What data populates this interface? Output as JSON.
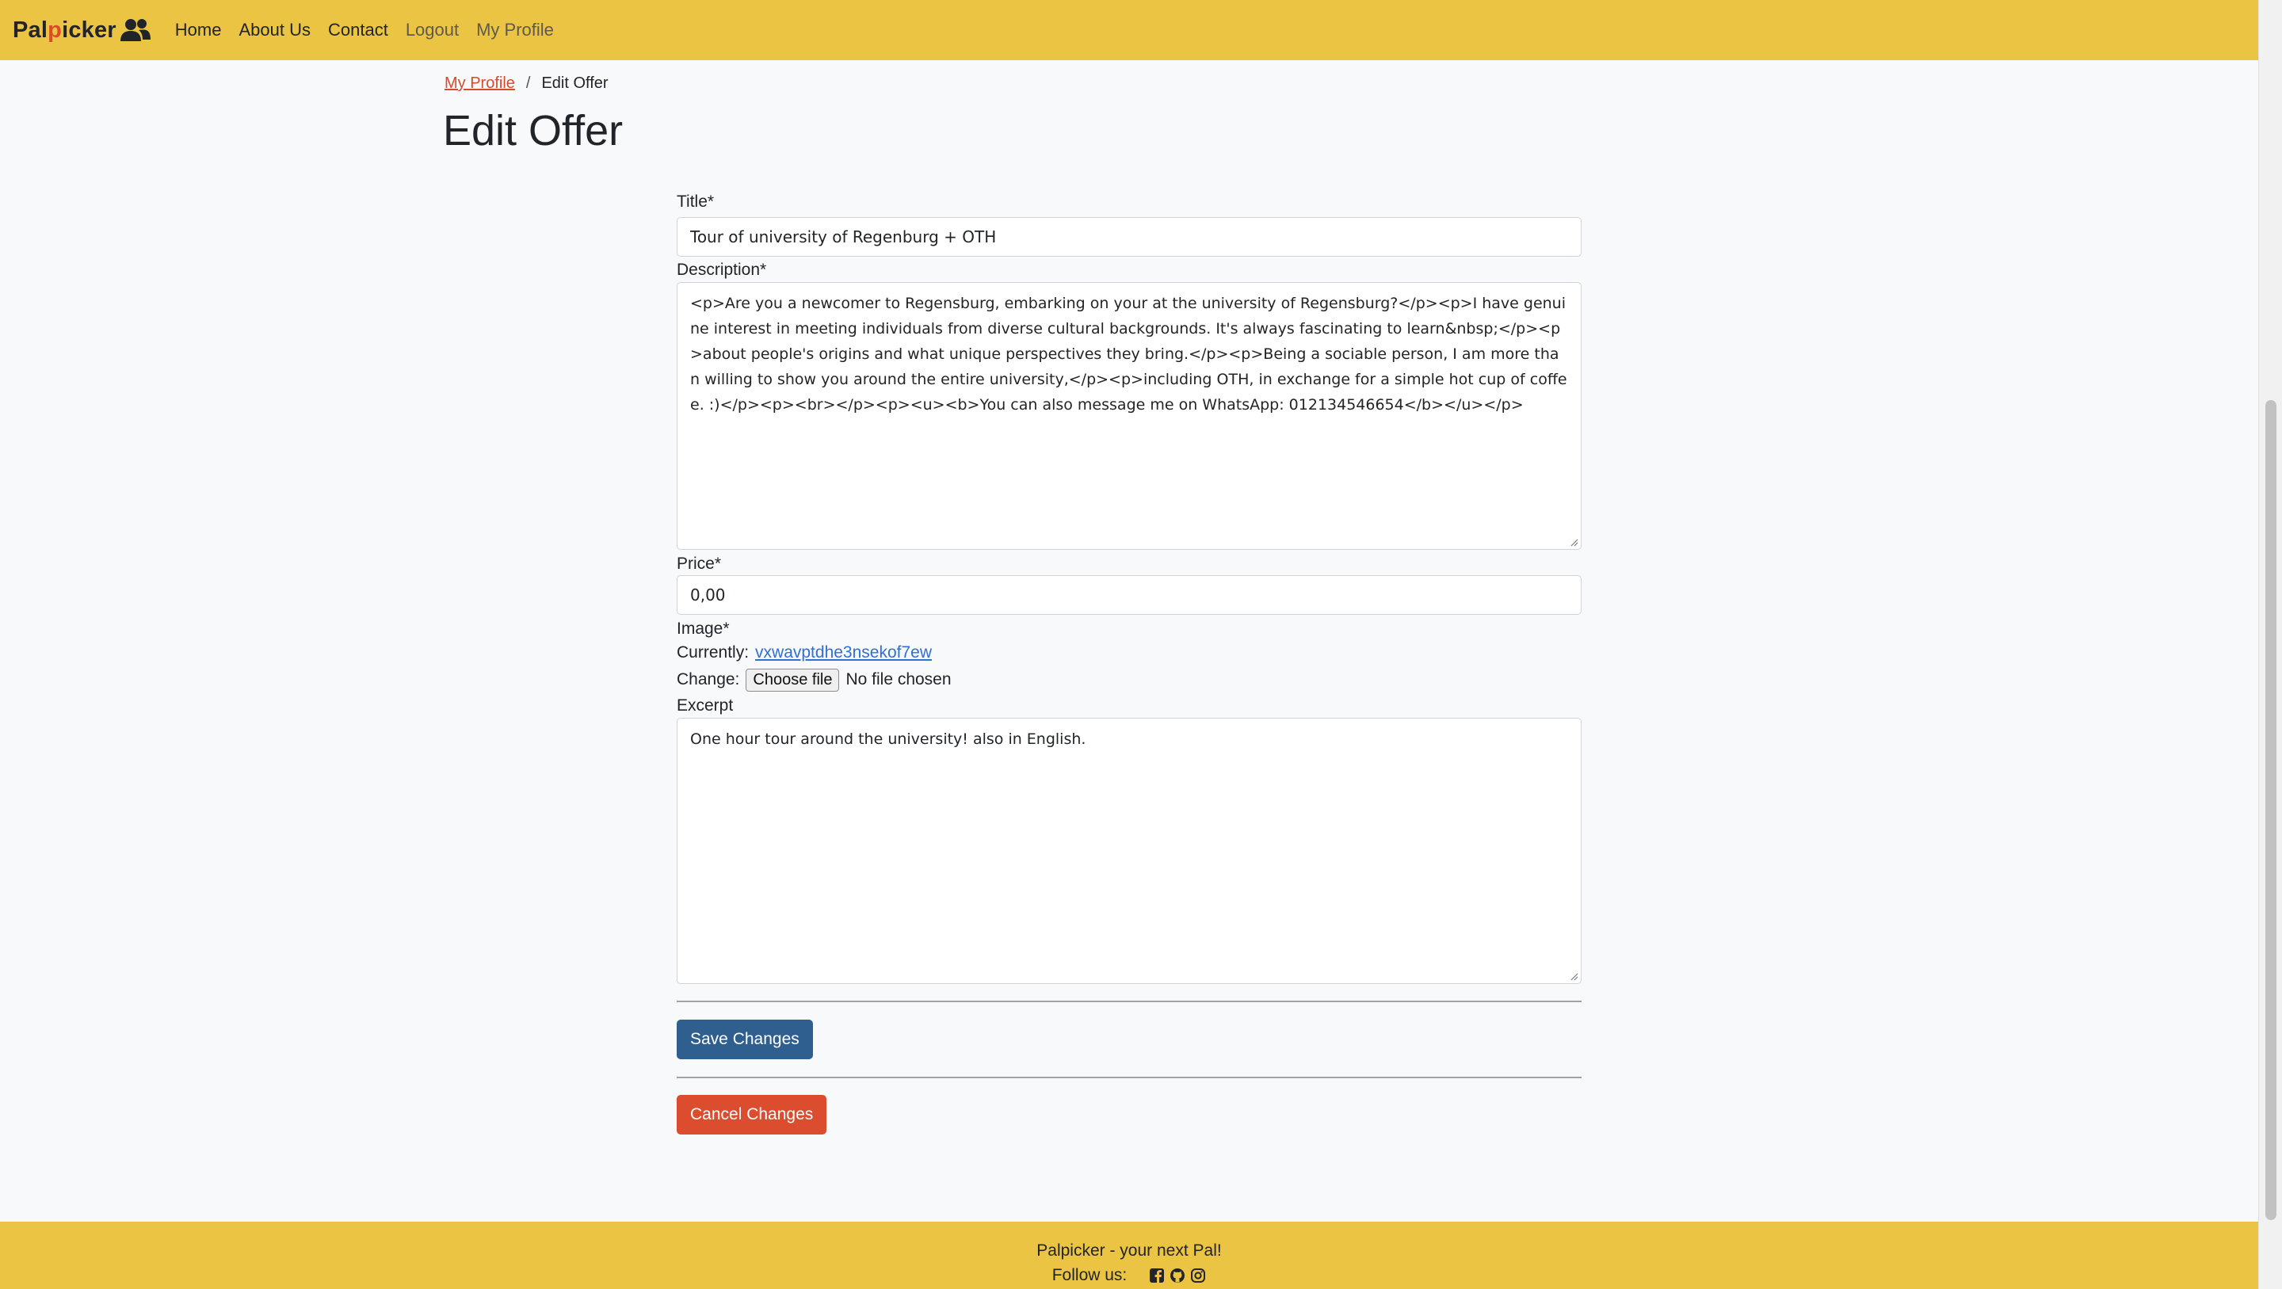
{
  "navbar": {
    "brand_pre": "Pal",
    "brand_p": "p",
    "brand_post": "icker",
    "links": [
      "Home",
      "About Us",
      "Contact",
      "Logout",
      "My Profile"
    ]
  },
  "breadcrumb": {
    "parent": "My Profile",
    "separator": "/",
    "current": "Edit Offer"
  },
  "page": {
    "title": "Edit Offer"
  },
  "form": {
    "title_label": "Title*",
    "title_value": "Tour of university of Regenburg + OTH",
    "description_label": "Description*",
    "description_value": "<p>Are you a newcomer to Regensburg, embarking on your at the university of Regensburg?</p><p>I have genuine interest in meeting individuals from diverse cultural backgrounds. It's always fascinating to learn&nbsp;</p><p>about people's origins and what unique perspectives they bring.</p><p>Being a sociable person, I am more than willing to show you around the entire university,</p><p>including OTH, in exchange for a simple hot cup of coffee. :)</p><p><br></p><p><u><b>You can also message me on WhatsApp: 012134546654</b></u></p>",
    "price_label": "Price*",
    "price_value": "0,00",
    "image_label": "Image*",
    "currently_label": "Currently:",
    "current_image": "vxwavptdhe3nsekof7ew",
    "change_label": "Change:",
    "choose_file": "Choose file",
    "no_file": "No file chosen",
    "excerpt_label": "Excerpt",
    "excerpt_value": "One hour tour around the university! also in English.",
    "save_button": "Save Changes",
    "cancel_button": "Cancel Changes"
  },
  "footer": {
    "tagline": "Palpicker - your next Pal!",
    "follow": "Follow us:",
    "social_icons": [
      "facebook-icon",
      "github-icon",
      "instagram-icon"
    ]
  },
  "colors": {
    "navbar": "#ecc444",
    "accent_red": "#dc4c2e",
    "save_blue": "#2f5f8e",
    "link_blue": "#2f6fd6"
  }
}
